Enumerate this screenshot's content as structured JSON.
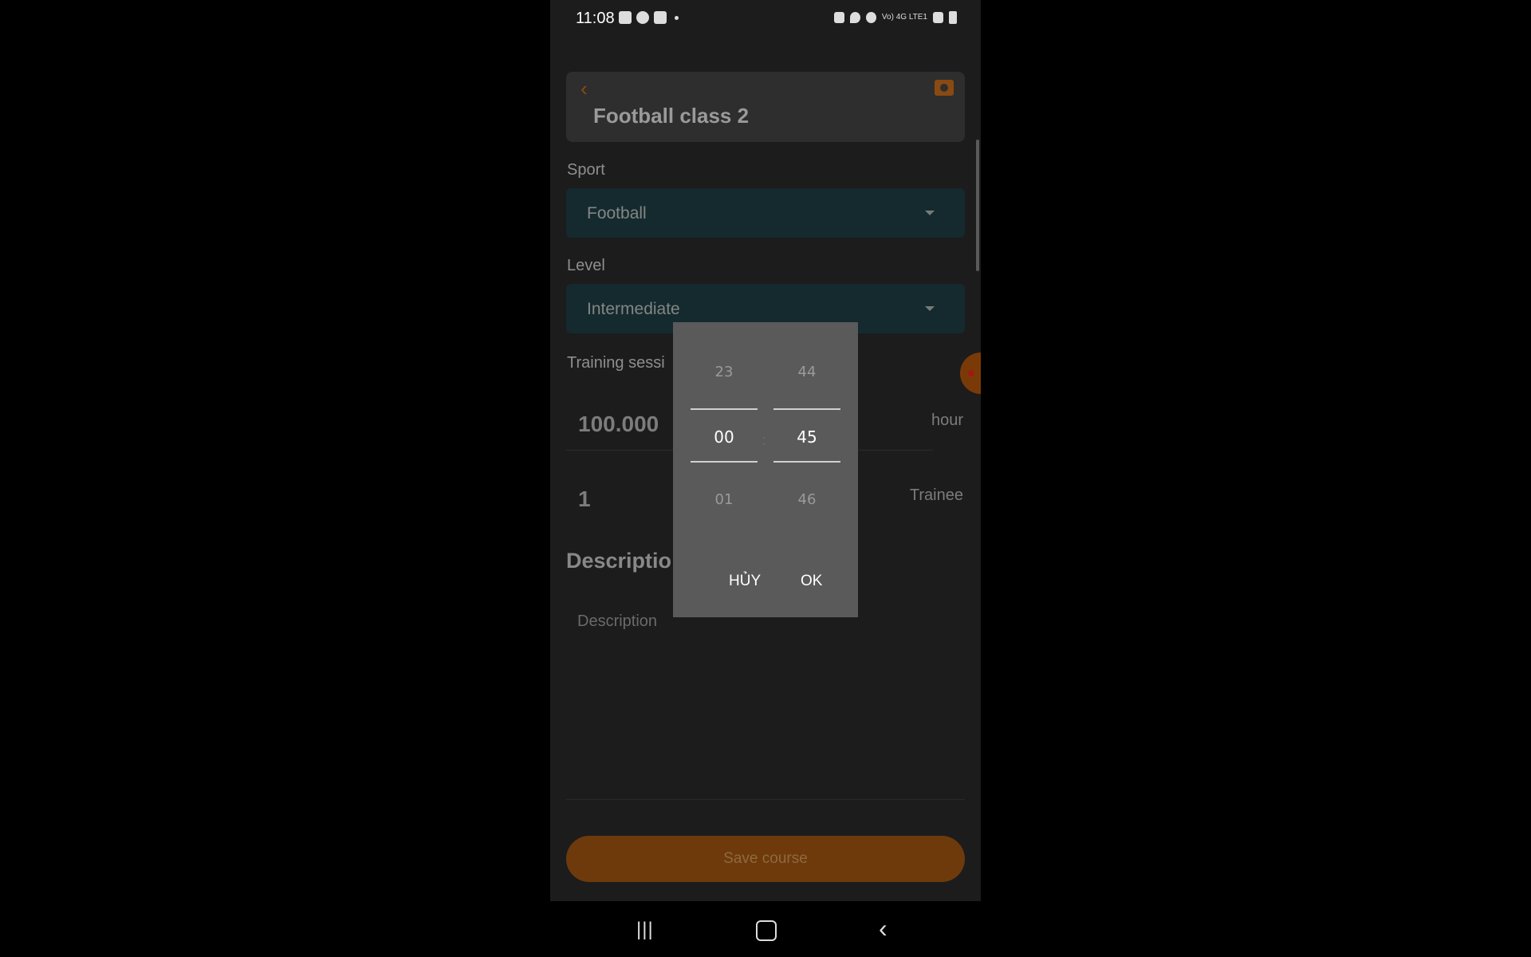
{
  "status_bar": {
    "time": "11:08",
    "network": "Vo) 4G LTE1"
  },
  "screen": {
    "title": "Football class 2",
    "sport": {
      "label": "Sport",
      "value": "Football"
    },
    "level": {
      "label": "Level",
      "value": "Intermediate"
    },
    "training_session_label": "Training sessi",
    "price": {
      "value": "100.000 ",
      "unit": "hour"
    },
    "trainees": {
      "value": "1",
      "unit": "Trainee"
    },
    "description": {
      "heading": "Descriptio",
      "placeholder": "Description"
    },
    "save_button": "Save course"
  },
  "time_picker": {
    "hours": {
      "prev": "23",
      "selected": "00",
      "next": "01"
    },
    "minutes": {
      "prev": "44",
      "selected": "45",
      "next": "46"
    },
    "separator": ":",
    "cancel_label": "HỦY",
    "ok_label": "OK"
  },
  "nav_bar": {
    "recent_symbol": "|||",
    "back_symbol": "‹"
  },
  "colors": {
    "accent": "#6e3a0c",
    "select_bg": "#142a2e",
    "dialog_bg": "#5a5a5a",
    "screen_bg": "#1c1c1c"
  },
  "icons": [
    "back-arrow-icon",
    "camera-icon",
    "dropdown-caret-icon",
    "recent-apps-icon",
    "home-icon",
    "back-icon"
  ]
}
